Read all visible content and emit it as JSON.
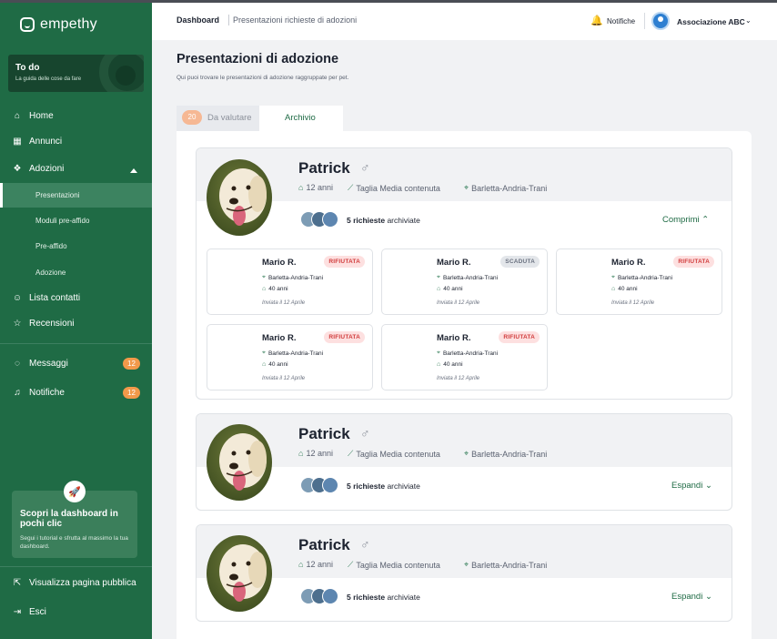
{
  "sidebar": {
    "brand": "empethy",
    "todo": {
      "title": "To do",
      "subtitle": "La guida delle cose da fare"
    },
    "items": [
      {
        "label": "Home",
        "icon": "home-icon"
      },
      {
        "label": "Annunci",
        "icon": "grid-icon"
      },
      {
        "label": "Adozioni",
        "icon": "paw-icon"
      },
      {
        "label": "Presentazioni"
      },
      {
        "label": "Moduli pre-affido"
      },
      {
        "label": "Pre-affido"
      },
      {
        "label": "Adozione"
      },
      {
        "label": "Lista contatti",
        "icon": "users-icon"
      },
      {
        "label": "Recensioni",
        "icon": "star-icon"
      },
      {
        "label": "Messaggi",
        "icon": "chat-icon",
        "badge": "12"
      },
      {
        "label": "Notifiche",
        "icon": "bell-icon",
        "badge": "12"
      }
    ],
    "promo": {
      "title": "Scopri la dashboard in pochi clic",
      "text": "Segui i tutorial e sfrutta al massimo la tua dashboard."
    },
    "public_page": "Visualizza pagina pubblica",
    "logout": "Esci"
  },
  "header": {
    "crumb_current": "Dashboard",
    "crumb_page": "Presentazioni richieste di adozioni",
    "notifications": "Notifiche",
    "account": "Associazione ABC"
  },
  "main": {
    "title": "Presentazioni di adozione",
    "subtitle": "Qui puoi trovare le presentazioni di adozione raggruppate per pet.",
    "tabs": [
      {
        "label": "Da valutare",
        "count": "20"
      },
      {
        "label": "Archivio"
      }
    ]
  },
  "pets": [
    {
      "name": "Patrick",
      "sex": "♂",
      "age": "12 anni",
      "size": "Taglia Media contenuta",
      "location": "Barletta-Andria-Trani",
      "requests_count": "5 richieste",
      "requests_label": "archiviate",
      "toggle": "Comprimi",
      "expanded": true,
      "applicants": [
        {
          "name": "Mario R.",
          "status": "RIFIUTATA",
          "location": "Barletta-Andria-Trani",
          "age": "40 anni",
          "sent": "Inviata il 12 Aprile"
        },
        {
          "name": "Mario R.",
          "status": "SCADUTA",
          "location": "Barletta-Andria-Trani",
          "age": "40 anni",
          "sent": "Inviata il 12 Aprile"
        },
        {
          "name": "Mario R.",
          "status": "RIFIUTATA",
          "location": "Barletta-Andria-Trani",
          "age": "40 anni",
          "sent": "Inviata il 12 Aprile"
        },
        {
          "name": "Mario R.",
          "status": "RIFIUTATA",
          "location": "Barletta-Andria-Trani",
          "age": "40 anni",
          "sent": "Inviata il 12 Aprile"
        },
        {
          "name": "Mario R.",
          "status": "RIFIUTATA",
          "location": "Barletta-Andria-Trani",
          "age": "40 anni",
          "sent": "Inviata il 12 Aprile"
        }
      ]
    },
    {
      "name": "Patrick",
      "sex": "♂",
      "age": "12 anni",
      "size": "Taglia Media contenuta",
      "location": "Barletta-Andria-Trani",
      "requests_count": "5 richieste",
      "requests_label": "archiviate",
      "toggle": "Espandi",
      "expanded": false
    },
    {
      "name": "Patrick",
      "sex": "♂",
      "age": "12 anni",
      "size": "Taglia Media contenuta",
      "location": "Barletta-Andria-Trani",
      "requests_count": "5 richieste",
      "requests_label": "archiviate",
      "toggle": "Espandi",
      "expanded": false
    }
  ],
  "colors": {
    "brand": "#1f6b45",
    "badge": "#f2994a",
    "rejected": "#d13b3b",
    "expired": "#6b7280"
  }
}
